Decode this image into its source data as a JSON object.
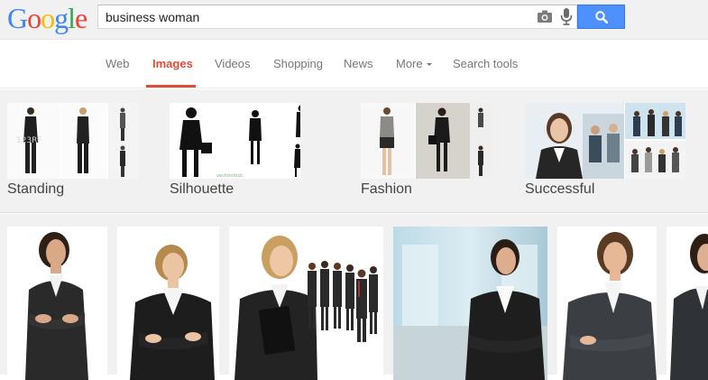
{
  "logo": {
    "letters": [
      "G",
      "o",
      "o",
      "g",
      "l",
      "e"
    ]
  },
  "search": {
    "query": "business woman",
    "camera_icon": "camera-icon",
    "mic_icon": "microphone-icon",
    "button_icon": "search-icon"
  },
  "nav": {
    "items": [
      {
        "label": "Web"
      },
      {
        "label": "Images"
      },
      {
        "label": "Videos"
      },
      {
        "label": "Shopping"
      },
      {
        "label": "News"
      },
      {
        "label": "More"
      },
      {
        "label": "Search tools"
      }
    ],
    "active": "Images"
  },
  "related": [
    {
      "label": "Standing"
    },
    {
      "label": "Silhouette"
    },
    {
      "label": "Fashion"
    },
    {
      "label": "Successful"
    }
  ],
  "colors": {
    "accent_red": "#dd4b39",
    "search_blue": "#4d90fe",
    "background": "#f1f1f1"
  }
}
